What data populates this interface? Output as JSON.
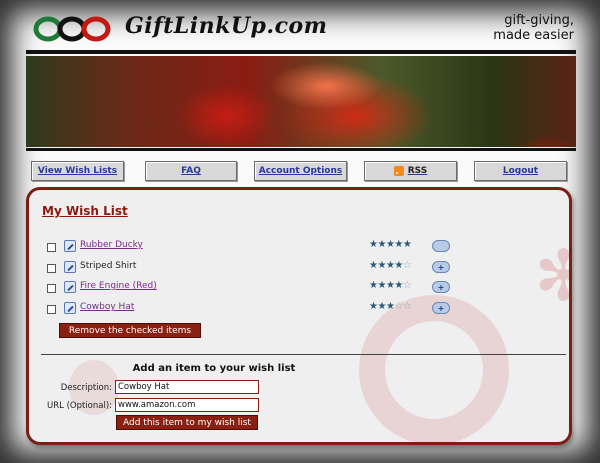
{
  "site": {
    "name": "GiftLinkUp.com",
    "tagline_line1": "gift-giving,",
    "tagline_line2": "made easier"
  },
  "nav": {
    "view_wish_lists": "View Wish Lists",
    "faq": "FAQ",
    "account_options": "Account Options",
    "rss": "RSS",
    "logout": "Logout"
  },
  "wishlist": {
    "title": "My Wish List",
    "items": [
      {
        "name": "Rubber Ducky",
        "linked": true,
        "rating": 5,
        "comment_icon": "speech-bubble-icon"
      },
      {
        "name": "Striped Shirt",
        "linked": false,
        "rating": 4,
        "comment_icon": "add-comment-icon"
      },
      {
        "name": "Fire Engine (Red)",
        "linked": true,
        "rating": 4,
        "comment_icon": "add-comment-icon"
      },
      {
        "name": "Cowboy Hat",
        "linked": true,
        "rating": 3,
        "comment_icon": "add-comment-icon"
      }
    ],
    "max_rating": 5,
    "remove_button": "Remove the checked items"
  },
  "add_form": {
    "heading": "Add an item to your wish list",
    "description_label": "Description:",
    "description_value": "Cowboy Hat",
    "url_label": "URL (Optional):",
    "url_value": "www.amazon.com",
    "submit_button": "Add this item to my wish list"
  },
  "colors": {
    "accent": "#8a2012",
    "link": "#2a3a9a",
    "visited": "#7a2a8a"
  }
}
